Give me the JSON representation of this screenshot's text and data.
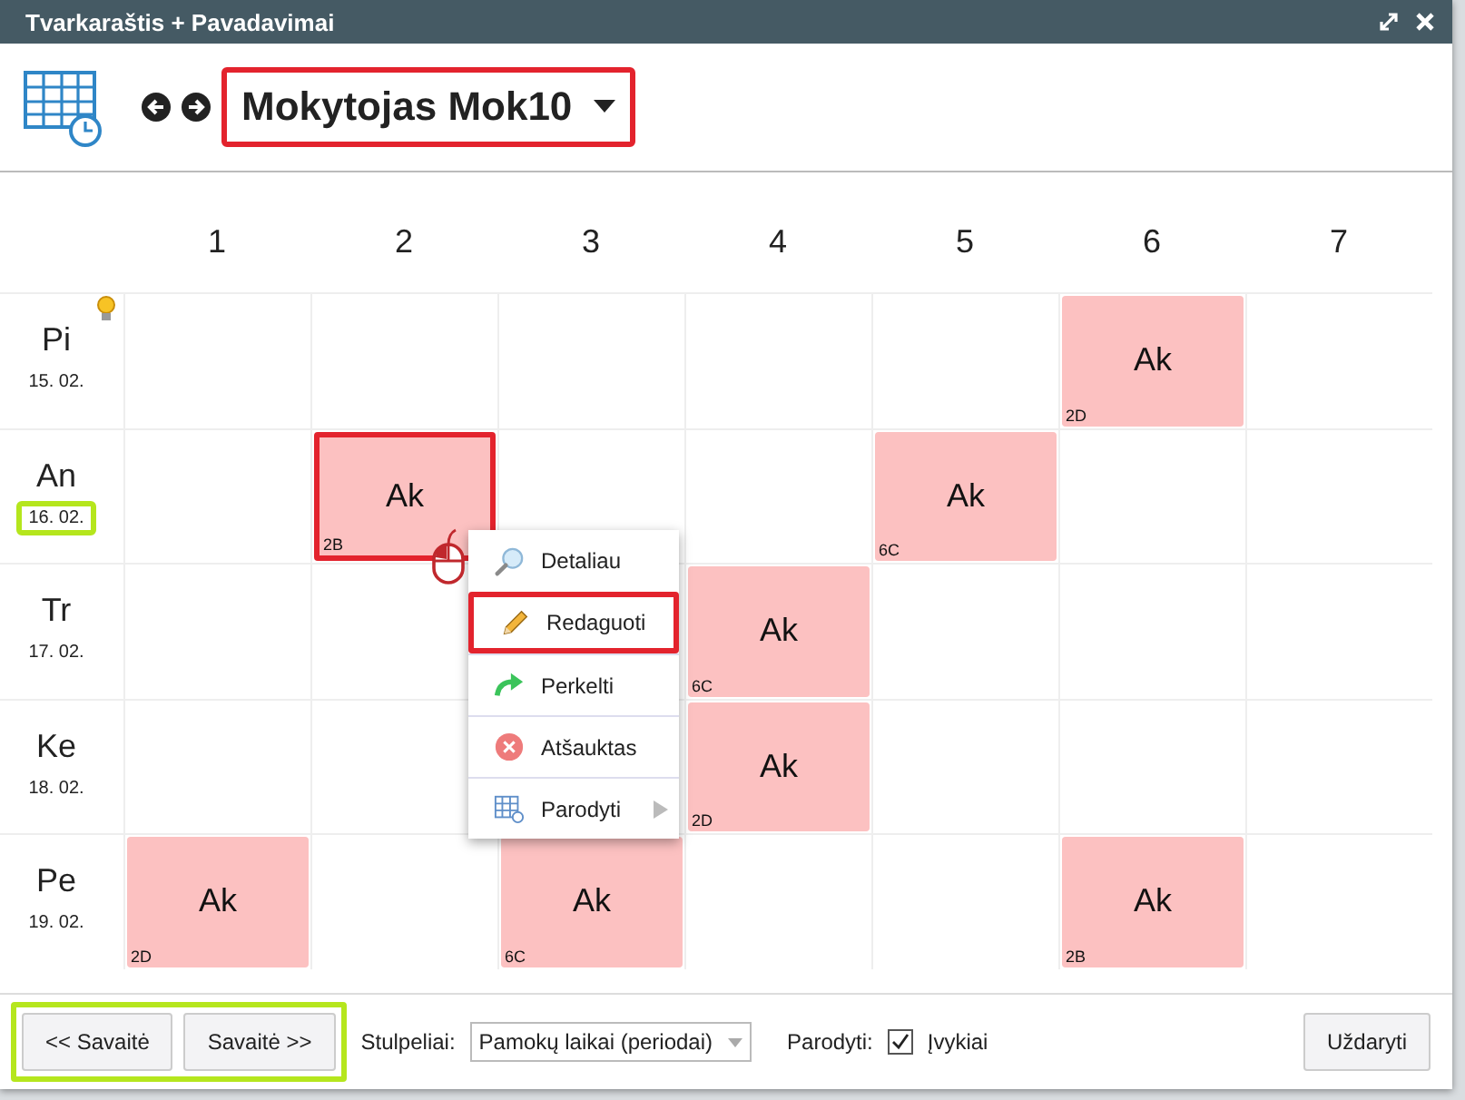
{
  "window": {
    "title": "Tvarkaraštis + Pavadavimai"
  },
  "header": {
    "selector": "Mokytojas Mok10",
    "highlighted": true
  },
  "periods": [
    "1",
    "2",
    "3",
    "4",
    "5",
    "6",
    "7"
  ],
  "days": [
    {
      "day": "Pi",
      "date": "15. 02.",
      "highlighted": false,
      "cells": [
        {
          "kind": "empty"
        },
        {
          "kind": "empty"
        },
        {
          "kind": "empty"
        },
        {
          "kind": "empty"
        },
        {
          "kind": "empty"
        },
        {
          "kind": "lesson",
          "subject": "Ak",
          "class": "2D",
          "highlighted": false
        },
        {
          "kind": "empty"
        }
      ]
    },
    {
      "day": "An",
      "date": "16. 02.",
      "highlighted": true,
      "cells": [
        {
          "kind": "empty"
        },
        {
          "kind": "lesson",
          "subject": "Ak",
          "class": "2B",
          "highlighted": true
        },
        {
          "kind": "empty"
        },
        {
          "kind": "empty"
        },
        {
          "kind": "lesson",
          "subject": "Ak",
          "class": "6C",
          "highlighted": false
        },
        {
          "kind": "empty"
        },
        {
          "kind": "empty"
        }
      ]
    },
    {
      "day": "Tr",
      "date": "17. 02.",
      "highlighted": false,
      "cells": [
        {
          "kind": "empty"
        },
        {
          "kind": "empty"
        },
        {
          "kind": "empty"
        },
        {
          "kind": "lesson",
          "subject": "Ak",
          "class": "6C",
          "highlighted": false
        },
        {
          "kind": "empty"
        },
        {
          "kind": "empty"
        },
        {
          "kind": "empty"
        }
      ]
    },
    {
      "day": "Ke",
      "date": "18. 02.",
      "highlighted": false,
      "cells": [
        {
          "kind": "empty"
        },
        {
          "kind": "empty"
        },
        {
          "kind": "empty"
        },
        {
          "kind": "lesson",
          "subject": "Ak",
          "class": "2D",
          "highlighted": false
        },
        {
          "kind": "empty"
        },
        {
          "kind": "empty"
        },
        {
          "kind": "empty"
        }
      ]
    },
    {
      "day": "Pe",
      "date": "19. 02.",
      "highlighted": false,
      "cells": [
        {
          "kind": "lesson",
          "subject": "Ak",
          "class": "2D",
          "highlighted": false
        },
        {
          "kind": "empty"
        },
        {
          "kind": "lesson",
          "subject": "Ak",
          "class": "6C",
          "highlighted": false
        },
        {
          "kind": "empty"
        },
        {
          "kind": "empty"
        },
        {
          "kind": "lesson",
          "subject": "Ak",
          "class": "2B",
          "highlighted": false
        },
        {
          "kind": "empty"
        }
      ]
    }
  ],
  "context_menu": [
    {
      "kind": "details",
      "label": "Detaliau",
      "highlighted": false,
      "submenu": false
    },
    {
      "kind": "edit",
      "label": "Redaguoti",
      "highlighted": true,
      "submenu": false
    },
    {
      "kind": "move",
      "label": "Perkelti",
      "highlighted": false,
      "submenu": false
    },
    {
      "kind": "cancel",
      "label": "Atšauktas",
      "highlighted": false,
      "submenu": false
    },
    {
      "kind": "show",
      "label": "Parodyti",
      "highlighted": false,
      "submenu": true
    }
  ],
  "footer": {
    "week_buttons": [
      "<< Savaitė",
      "Savaitė >>"
    ],
    "week_buttons_highlighted": true,
    "columns_label": "Stulpeliai:",
    "columns_value": "Pamokų laikai (periodai)",
    "show_label": "Parodyti:",
    "events_label": "Įvykiai",
    "events_checked": true,
    "close": "Uždaryti"
  }
}
